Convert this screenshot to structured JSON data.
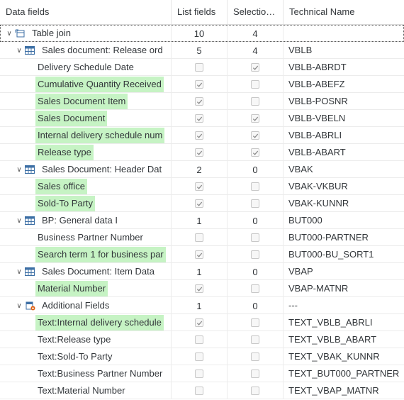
{
  "columns": [
    "Data fields",
    "List fields",
    "Selectio…",
    "Technical Name"
  ],
  "rows": [
    {
      "level": 0,
      "type": "root",
      "icon": "table-join-icon",
      "expanded": true,
      "label": "Table join",
      "list": "10",
      "sel": "4",
      "tech": "",
      "selected": true
    },
    {
      "level": 1,
      "type": "group",
      "icon": "table-icon",
      "expanded": true,
      "label": "Sales document: Release ord",
      "list": "5",
      "sel": "4",
      "tech": "VBLB"
    },
    {
      "level": 2,
      "type": "field",
      "label": "Delivery Schedule Date",
      "highlight": false,
      "listChecked": false,
      "selChecked": true,
      "tech": "VBLB-ABRDT"
    },
    {
      "level": 2,
      "type": "field",
      "label": "Cumulative Quantity Received",
      "highlight": true,
      "listChecked": true,
      "selChecked": false,
      "tech": "VBLB-ABEFZ"
    },
    {
      "level": 2,
      "type": "field",
      "label": "Sales Document Item",
      "highlight": true,
      "listChecked": true,
      "selChecked": false,
      "tech": "VBLB-POSNR"
    },
    {
      "level": 2,
      "type": "field",
      "label": "Sales Document",
      "highlight": true,
      "listChecked": true,
      "selChecked": true,
      "tech": "VBLB-VBELN"
    },
    {
      "level": 2,
      "type": "field",
      "label": "Internal delivery schedule num",
      "highlight": true,
      "listChecked": true,
      "selChecked": true,
      "tech": "VBLB-ABRLI"
    },
    {
      "level": 2,
      "type": "field",
      "label": "Release type",
      "highlight": true,
      "listChecked": true,
      "selChecked": true,
      "tech": "VBLB-ABART"
    },
    {
      "level": 1,
      "type": "group",
      "icon": "table-icon",
      "expanded": true,
      "label": "Sales Document: Header Dat",
      "list": "2",
      "sel": "0",
      "tech": "VBAK"
    },
    {
      "level": 2,
      "type": "field",
      "label": "Sales office",
      "highlight": true,
      "listChecked": true,
      "selChecked": false,
      "tech": "VBAK-VKBUR"
    },
    {
      "level": 2,
      "type": "field",
      "label": "Sold-To Party",
      "highlight": true,
      "listChecked": true,
      "selChecked": false,
      "tech": "VBAK-KUNNR"
    },
    {
      "level": 1,
      "type": "group",
      "icon": "table-icon",
      "expanded": true,
      "label": "BP: General data I",
      "list": "1",
      "sel": "0",
      "tech": "BUT000"
    },
    {
      "level": 2,
      "type": "field",
      "label": "Business Partner Number",
      "highlight": false,
      "listChecked": false,
      "selChecked": false,
      "tech": "BUT000-PARTNER"
    },
    {
      "level": 2,
      "type": "field",
      "label": "Search term 1 for business par",
      "highlight": true,
      "listChecked": true,
      "selChecked": false,
      "tech": "BUT000-BU_SORT1"
    },
    {
      "level": 1,
      "type": "group",
      "icon": "table-icon",
      "expanded": true,
      "label": "Sales Document: Item Data",
      "list": "1",
      "sel": "0",
      "tech": "VBAP"
    },
    {
      "level": 2,
      "type": "field",
      "label": "Material Number",
      "highlight": true,
      "listChecked": true,
      "selChecked": false,
      "tech": "VBAP-MATNR"
    },
    {
      "level": 1,
      "type": "group",
      "icon": "additional-fields-icon",
      "expanded": true,
      "label": "Additional Fields",
      "list": "1",
      "sel": "0",
      "tech": "---"
    },
    {
      "level": 2,
      "type": "field",
      "label": "Text:Internal delivery schedule",
      "highlight": true,
      "listChecked": true,
      "selChecked": false,
      "tech": "TEXT_VBLB_ABRLI"
    },
    {
      "level": 2,
      "type": "field",
      "label": "Text:Release type",
      "highlight": false,
      "listChecked": false,
      "selChecked": false,
      "tech": "TEXT_VBLB_ABART"
    },
    {
      "level": 2,
      "type": "field",
      "label": "Text:Sold-To Party",
      "highlight": false,
      "listChecked": false,
      "selChecked": false,
      "tech": "TEXT_VBAK_KUNNR"
    },
    {
      "level": 2,
      "type": "field",
      "label": "Text:Business Partner Number",
      "highlight": false,
      "listChecked": false,
      "selChecked": false,
      "tech": "TEXT_BUT000_PARTNER"
    },
    {
      "level": 2,
      "type": "field",
      "label": "Text:Material Number",
      "highlight": false,
      "listChecked": false,
      "selChecked": false,
      "tech": "TEXT_VBAP_MATNR"
    }
  ],
  "colors": {
    "highlight": "#c6f3c4",
    "check": "#8a8a8a"
  }
}
